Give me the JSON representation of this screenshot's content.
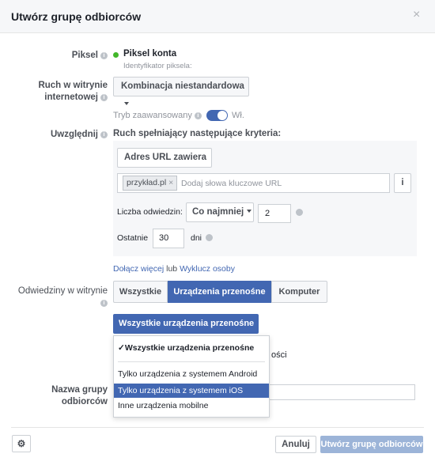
{
  "dialog": {
    "title": "Utwórz grupę odbiorców",
    "close_glyph": "×"
  },
  "pixel": {
    "label": "Piksel",
    "name": "Piksel konta",
    "id_label": "Identyfikator piksela:",
    "status_color": "#42b72a"
  },
  "traffic": {
    "label_line1": "Ruch w witrynie",
    "label_line2": "internetowej",
    "selected": "Kombinacja niestandardowa"
  },
  "advanced": {
    "label": "Tryb zaawansowany",
    "toggle_state": "Wł.",
    "toggle_on": true
  },
  "include": {
    "label": "Uwzględnij",
    "criteria_text": "Ruch spełniający następujące kryteria:",
    "rule_selected": "Adres URL zawiera",
    "keyword_tag": "przykład.pl",
    "keyword_tag_remove": "×",
    "keyword_placeholder": "Dodaj słowa kluczowe URL",
    "info_button": "i",
    "visits_label": "Liczba odwiedzin:",
    "visits_operator": "Co najmniej",
    "visits_value": "2",
    "recent_label": "Ostatnie",
    "recent_value": "30",
    "days_label": "dni"
  },
  "links": {
    "add_more": "Dołącz więcej",
    "or": "lub",
    "exclude": "Wyklucz osoby"
  },
  "visited": {
    "label_line1": "Odwiedziny w witrynie",
    "segments": [
      "Wszystkie",
      "Urządzenia przenośne",
      "Komputer"
    ],
    "active_index": 1,
    "device_dropdown": "Wszystkie urządzenia przenośne",
    "hidden_suffix": "ości"
  },
  "device_menu": {
    "items": [
      {
        "label": "Wszystkie urządzenia przenośne",
        "checked": true,
        "check_glyph": "✓"
      },
      {
        "label": "Tylko urządzenia z systemem Android"
      },
      {
        "label": "Tylko urządzenia z systemem iOS",
        "highlighted": true
      },
      {
        "label": "Inne urządzenia mobilne"
      }
    ]
  },
  "audience_name": {
    "label_line1": "Nazwa grupy",
    "label_line2": "odbiorców",
    "value": ""
  },
  "footer": {
    "settings_glyph": "⚙",
    "cancel": "Anuluj",
    "create": "Utwórz grupę odbiorców"
  },
  "colors": {
    "accent": "#4267b2",
    "create_disabled": "#9cb4d8",
    "header_bg": "#f6f7f9",
    "border": "#ccd0d5"
  }
}
